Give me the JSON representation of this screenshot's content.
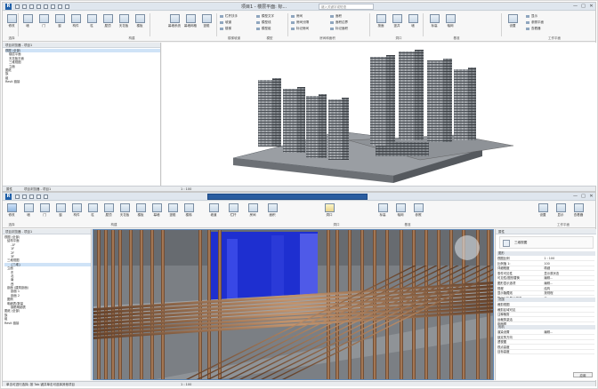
{
  "top_window": {
    "title": "项目1 - 楼层平面: 标...",
    "search_placeholder": "键入关键字或短语",
    "window_controls": [
      "—",
      "□",
      "✕"
    ],
    "ribbon_buttons": [
      "修改",
      "墙",
      "门",
      "窗",
      "构件",
      "柱",
      "屋顶",
      "天花板",
      "楼板",
      "幕墙系统",
      "幕墙网格",
      "竖梃"
    ],
    "ribbon_small": [
      "栏杆扶手",
      "坡道",
      "楼梯",
      "模型文字",
      "模型线",
      "模型组",
      "房间",
      "房间分隔",
      "标记房间",
      "面积",
      "面积边界",
      "标记面积"
    ],
    "panel_labels": [
      "选择",
      "构建",
      "楼梯坡道",
      "模型",
      "房间和面积",
      "洞口",
      "基准",
      "工作平面"
    ],
    "right_buttons": [
      "按面",
      "竖井",
      "墙",
      "标高",
      "轴网",
      "设置",
      "显示",
      "参照平面",
      "查看器"
    ],
    "browser_title": "项目浏览器 - 项目1",
    "browser_items": [
      "视图 (全部)",
      "楼层平面",
      "天花板平面",
      "三维视图",
      "立面",
      "图纸",
      "族",
      "组",
      "Revit 链接"
    ],
    "status_left": "属性",
    "status_tabs": [
      "项目浏览器 - 项目1"
    ],
    "status_scale": "1 : 100"
  },
  "bottom_window": {
    "ribbon_buttons": [
      "修改",
      "墙",
      "门",
      "窗",
      "构件",
      "柱",
      "屋顶",
      "天花板",
      "楼板",
      "幕墙",
      "竖梃",
      "楼梯",
      "坡道",
      "栏杆",
      "房间",
      "面积",
      "洞口",
      "标高",
      "轴网",
      "参照",
      "设置",
      "显示",
      "查看器"
    ],
    "panel_labels": [
      "选择",
      "构建",
      "洞口",
      "基准",
      "工作平面"
    ],
    "browser_items": [
      "视图 (全部)",
      "结构平面",
      "-1F",
      "1F",
      "2F",
      "3F",
      "三维视图",
      "{三维}",
      "立面",
      "东",
      "北",
      "南",
      "西",
      "剖面 (建筑剖面)",
      "剖面 1",
      "剖面 2",
      "图例",
      "明细表/数量",
      "钢筋明细表",
      "图纸 (全部)",
      "族",
      "组",
      "Revit 链接"
    ],
    "props_type": "三维视图",
    "props_group1": "图形",
    "props_rows": [
      [
        "视图比例",
        "1 : 100"
      ],
      [
        "比例值 1:",
        "100"
      ],
      [
        "详细程度",
        "精细"
      ],
      [
        "零件可见性",
        "显示原状态"
      ],
      [
        "可见性/图形替换",
        "编辑..."
      ],
      [
        "图形显示选项",
        "编辑..."
      ],
      [
        "规程",
        "结构"
      ],
      [
        "显示隐藏线",
        "按规程"
      ],
      [
        "默认分析显示样式",
        "无"
      ]
    ],
    "props_group2": "范围",
    "props_rows2": [
      [
        "裁剪视图",
        ""
      ],
      [
        "裁剪区域可见",
        ""
      ],
      [
        "注释裁剪",
        ""
      ],
      [
        "远裁剪激活",
        ""
      ],
      [
        "剖面框",
        ""
      ]
    ],
    "props_group3": "相机",
    "props_rows3": [
      [
        "渲染设置",
        "编辑..."
      ],
      [
        "锁定的方向",
        ""
      ],
      [
        "透视图",
        ""
      ],
      [
        "视点高度",
        ""
      ],
      [
        "目标高度",
        ""
      ]
    ],
    "props_apply": "应用",
    "status_text": "单击可进行选择; 按 Tab 键并单击可选择其他项目",
    "status_scale": "1 : 100",
    "props_title": "属性"
  },
  "colors": {
    "accent": "#1f5fa8",
    "rebar": "#8a5a3c",
    "blue_core": "#1e2fd0",
    "viewport_bg": "#787c80"
  }
}
